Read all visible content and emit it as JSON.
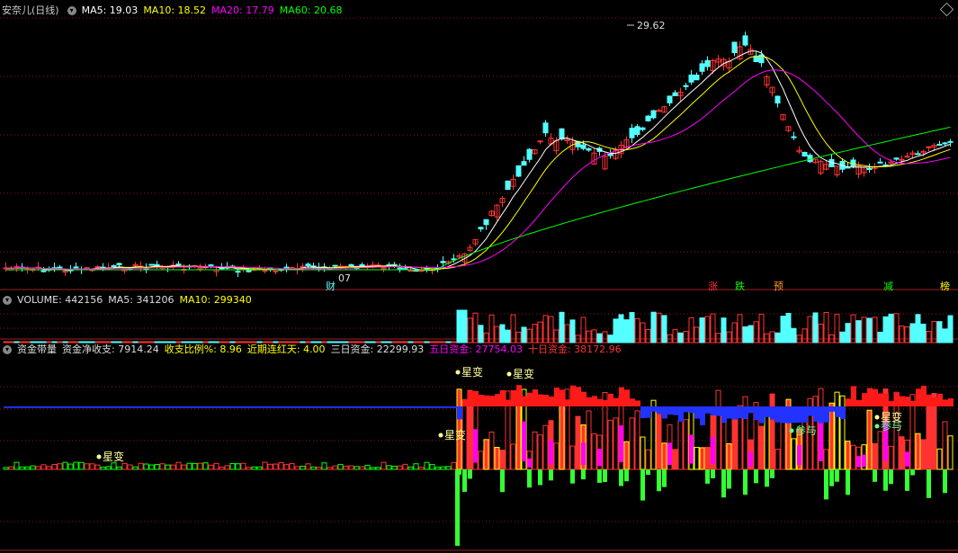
{
  "price_panel": {
    "stock_name": "安奈儿(日线)",
    "ma5": "MA5: 19.03",
    "ma10": "MA10: 18.52",
    "ma20": "MA20: 17.79",
    "ma60": "MA60: 20.68",
    "peak_label": "29.62",
    "low_label": "07",
    "event_tags": [
      "财",
      "涨",
      "跌",
      "预",
      "减",
      "榜"
    ]
  },
  "volume_panel": {
    "title": "VOLUME: 442156",
    "ma5": "MA5: 341206",
    "ma10": "MA10: 299340"
  },
  "fund_panel": {
    "title": "资金带量",
    "net_flow": "资金净收支: 7914.24",
    "ratio": "收支比例%: 8.96",
    "red_days": "近期连红天: 4.00",
    "three_day": "三日资金: 22299.93",
    "five_day": "五日资金: 27754.03",
    "ten_day": "十日资金: 38172.96",
    "signals": [
      "星变",
      "星变",
      "星变",
      "星变",
      "参与",
      "参与",
      "星变"
    ]
  },
  "colors": {
    "up": "#ff3232",
    "down": "#54ffff",
    "ma5": "#ffffff",
    "ma10": "#ffff00",
    "ma20": "#ff00ff",
    "ma60": "#00ff00",
    "grid": "#8b1a1a"
  }
}
